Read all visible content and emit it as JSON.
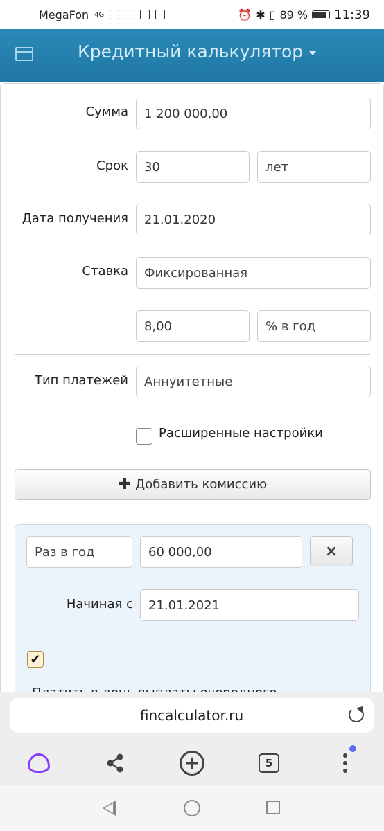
{
  "status_bar": {
    "carrier": "MegaFon",
    "network": "4G",
    "battery": "89 %",
    "time": "11:39"
  },
  "header": {
    "title": "Кредитный калькулятор"
  },
  "form": {
    "amount_label": "Сумма",
    "amount_value": "1 200 000,00",
    "term_label": "Срок",
    "term_value": "30",
    "term_unit": "лет",
    "date_label": "Дата получения",
    "date_value": "21.01.2020",
    "rate_label": "Ставка",
    "rate_type": "Фиксированная",
    "rate_value": "8,00",
    "rate_unit": "% в год",
    "payment_type_label": "Тип платежей",
    "payment_type_value": "Аннуитетные",
    "advanced_label": "Расширенные настройки",
    "add_commission_label": "Добавить комиссию"
  },
  "commission": {
    "frequency": "Раз в год",
    "amount": "60 000,00",
    "remove_icon": "×",
    "start_label": "Начиная с",
    "start_date": "21.01.2021",
    "checkbox_checked": true,
    "checkbox_mark": "✔",
    "pay_on_day_label": "Платить в день выплаты очередного"
  },
  "browser": {
    "url": "fincalculator.ru",
    "tabs_count": "5",
    "accent_color": "#8a3cff",
    "notify_color": "#5b6cf5"
  }
}
